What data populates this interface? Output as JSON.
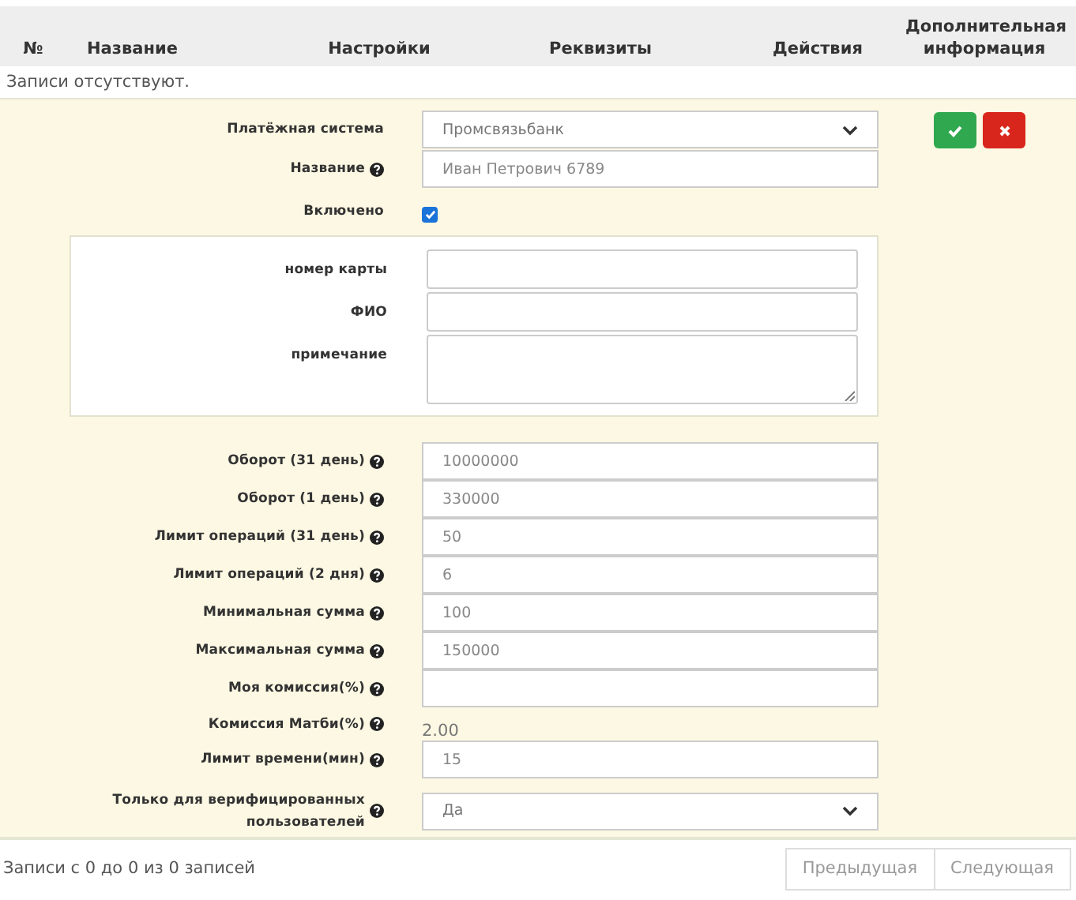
{
  "table": {
    "columns": [
      {
        "label": "№"
      },
      {
        "label": "Название"
      },
      {
        "label": "Настройки"
      },
      {
        "label": "Реквизиты"
      },
      {
        "label": "Действия"
      },
      {
        "label": "Дополнительная информация"
      }
    ],
    "empty_message": "Записи отсутствуют."
  },
  "form": {
    "fields": [
      {
        "kind": "select",
        "label": "Платёжная система",
        "help": false,
        "value": "Промсвязьбанк"
      },
      {
        "kind": "text",
        "label": "Название",
        "help": true,
        "value": "Иван Петрович 6789"
      },
      {
        "kind": "checkbox",
        "label": "Включено",
        "help": false,
        "checked": true
      },
      {
        "kind": "group",
        "fields": [
          {
            "kind": "text",
            "label": "номер карты"
          },
          {
            "kind": "text",
            "label": "ФИО"
          },
          {
            "kind": "textarea",
            "label": "примечание"
          }
        ]
      },
      {
        "kind": "text",
        "label": "Оборот (31 день)",
        "help": true,
        "value": "10000000"
      },
      {
        "kind": "text",
        "label": "Оборот (1 день)",
        "help": true,
        "value": "330000"
      },
      {
        "kind": "text",
        "label": "Лимит операций (31 день)",
        "help": true,
        "value": "50"
      },
      {
        "kind": "text",
        "label": "Лимит операций (2 дня)",
        "help": true,
        "value": "6"
      },
      {
        "kind": "text",
        "label": "Минимальная сумма",
        "help": true,
        "value": "100"
      },
      {
        "kind": "text",
        "label": "Максимальная сумма",
        "help": true,
        "value": "150000"
      },
      {
        "kind": "text",
        "label": "Моя комиссия(%)",
        "help": true
      },
      {
        "kind": "static",
        "label": "Комиссия Матби(%)",
        "help": true,
        "value": "2.00"
      },
      {
        "kind": "text",
        "label": "Лимит времени(мин)",
        "help": true,
        "value": "15"
      },
      {
        "kind": "select",
        "label": "Только для верифицированных пользователей",
        "help": true,
        "value": "Да"
      }
    ],
    "actions": [
      {
        "kind": "confirm"
      },
      {
        "kind": "cancel"
      }
    ]
  },
  "footer": {
    "info": "Записи с 0 до 0 из 0 записей",
    "pagination": [
      {
        "label": "Предыдущая",
        "disabled": true
      },
      {
        "label": "Следующая",
        "disabled": true
      }
    ]
  }
}
